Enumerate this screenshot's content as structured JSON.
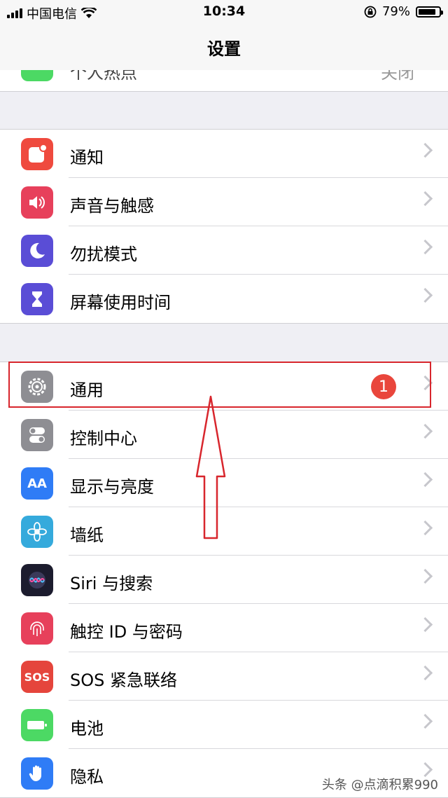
{
  "status_bar": {
    "carrier": "中国电信",
    "time": "10:34",
    "battery": "79%"
  },
  "nav": {
    "title": "设置"
  },
  "partial_row": {
    "label": "个人热点",
    "value": "关闭"
  },
  "group1": [
    {
      "label": "通知",
      "icon": "notification-icon",
      "color": "#ef4a3e"
    },
    {
      "label": "声音与触感",
      "icon": "sound-icon",
      "color": "#e7405b"
    },
    {
      "label": "勿扰模式",
      "icon": "moon-icon",
      "color": "#5a4dd6"
    },
    {
      "label": "屏幕使用时间",
      "icon": "hourglass-icon",
      "color": "#5a4dd6"
    }
  ],
  "group2": [
    {
      "label": "通用",
      "icon": "gear-icon",
      "color": "#8e8e93",
      "badge": "1"
    },
    {
      "label": "控制中心",
      "icon": "toggle-icon",
      "color": "#8e8e93"
    },
    {
      "label": "显示与亮度",
      "icon": "display-icon",
      "color": "#2f7cf6",
      "glyph": "AA"
    },
    {
      "label": "墙纸",
      "icon": "flower-icon",
      "color": "#35aadc"
    },
    {
      "label": "Siri 与搜索",
      "icon": "siri-icon",
      "color": "#1c1c2e"
    },
    {
      "label": "触控 ID 与密码",
      "icon": "fingerprint-icon",
      "color": "#e7405b"
    },
    {
      "label": "SOS 紧急联络",
      "icon": "sos-icon",
      "color": "#e5453c",
      "glyph": "SOS"
    },
    {
      "label": "电池",
      "icon": "battery-icon",
      "color": "#4cd964"
    },
    {
      "label": "隐私",
      "icon": "hand-icon",
      "color": "#2f7cf6"
    }
  ],
  "watermark": "头条 @点滴积累990"
}
